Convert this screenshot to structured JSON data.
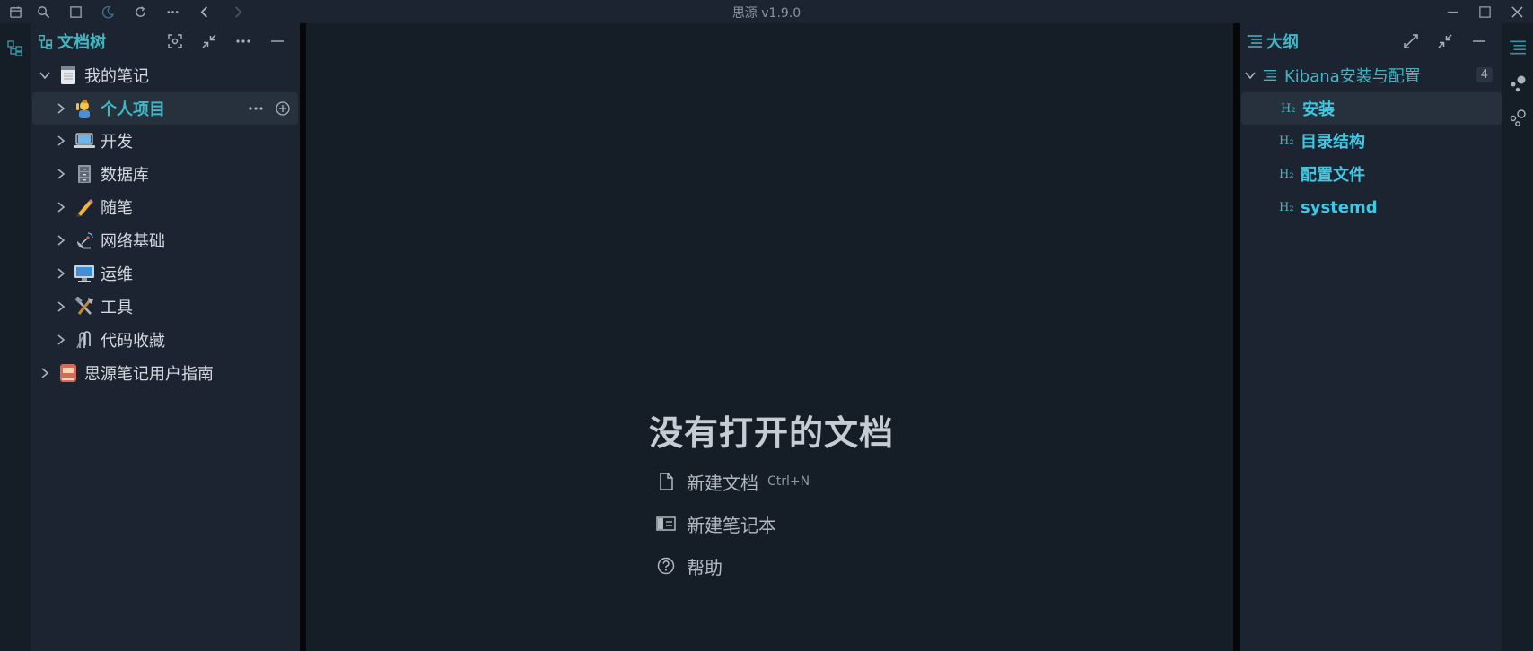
{
  "app": {
    "title": "思源 v1.9.0"
  },
  "colors": {
    "accent": "#3fb8c4",
    "panel_bg": "#1b2430",
    "editor_bg": "#151d27"
  },
  "topbar": {
    "left_icons": [
      "calendar-icon",
      "search-icon",
      "square-icon",
      "moon-icon",
      "sync-icon",
      "more-icon",
      "back-icon",
      "forward-icon"
    ],
    "right_icons": [
      "minimize-icon",
      "maximize-icon",
      "close-icon"
    ]
  },
  "file_panel": {
    "title": "文档树",
    "header_icons": [
      "focus-icon",
      "collapse-icon",
      "more-icon",
      "minimize-icon"
    ],
    "notebooks": [
      {
        "label": "我的笔记",
        "icon": "notepad-emoji",
        "expanded": true,
        "docs": [
          {
            "label": "个人项目",
            "icon": "person-emoji",
            "active": true
          },
          {
            "label": "开发",
            "icon": "laptop-emoji"
          },
          {
            "label": "数据库",
            "icon": "cabinet-emoji"
          },
          {
            "label": "随笔",
            "icon": "pencil-emoji"
          },
          {
            "label": "网络基础",
            "icon": "satellite-emoji"
          },
          {
            "label": "运维",
            "icon": "desktop-emoji"
          },
          {
            "label": "工具",
            "icon": "tools-emoji"
          },
          {
            "label": "代码收藏",
            "icon": "paperclip-emoji"
          }
        ]
      },
      {
        "label": "思源笔记用户指南",
        "icon": "book-emoji",
        "expanded": false
      }
    ]
  },
  "editor": {
    "empty_title": "没有打开的文档",
    "actions": [
      {
        "label": "新建文档",
        "shortcut": "Ctrl+N",
        "icon": "file-icon"
      },
      {
        "label": "新建笔记本",
        "shortcut": "",
        "icon": "notebook-icon"
      },
      {
        "label": "帮助",
        "shortcut": "",
        "icon": "help-icon"
      }
    ]
  },
  "outline_panel": {
    "title": "大纲",
    "header_icons": [
      "expand-icon",
      "collapse-icon",
      "minimize-icon"
    ],
    "doc_title": "Kibana安装与配置",
    "count": "4",
    "heading_tag": "H₂",
    "headings": [
      {
        "label": "安装",
        "active": true
      },
      {
        "label": "目录结构"
      },
      {
        "label": "配置文件"
      },
      {
        "label": "systemd"
      }
    ]
  },
  "right_dock": {
    "icons": [
      "outline-icon",
      "graph-icon",
      "global-graph-icon"
    ]
  },
  "left_dock": {
    "icons": [
      "file-tree-icon"
    ]
  }
}
